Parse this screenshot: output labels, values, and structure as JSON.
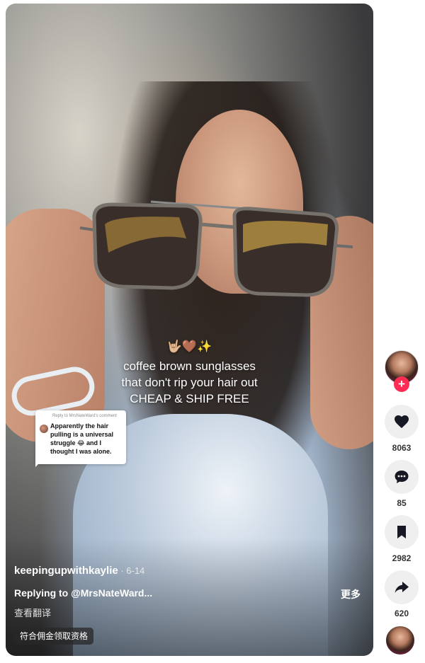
{
  "caption": {
    "emoji": "🤟🏼🤎✨",
    "line1": "coffee brown sunglasses",
    "line2": "that don't rip your hair out",
    "line3": "CHEAP & SHIP FREE"
  },
  "reply_card": {
    "header": "Reply to MrsNateWard's comment",
    "text": "Apparently the hair pulling is a universal struggle 😂 and I thought I was alone."
  },
  "post": {
    "author": "keepingupwithkaylie",
    "date": " · 6-14",
    "reply_text": "Replying to @MrsNateWard...",
    "more_label": "更多",
    "translate_label": "查看翻译",
    "badge": "符合佣金领取资格"
  },
  "actions": {
    "follow_label": "+",
    "likes": "8063",
    "comments": "85",
    "saves": "2982",
    "shares": "620"
  },
  "colors": {
    "accent": "#fe2c55",
    "icon": "#161823",
    "button_bg": "#efefef"
  }
}
